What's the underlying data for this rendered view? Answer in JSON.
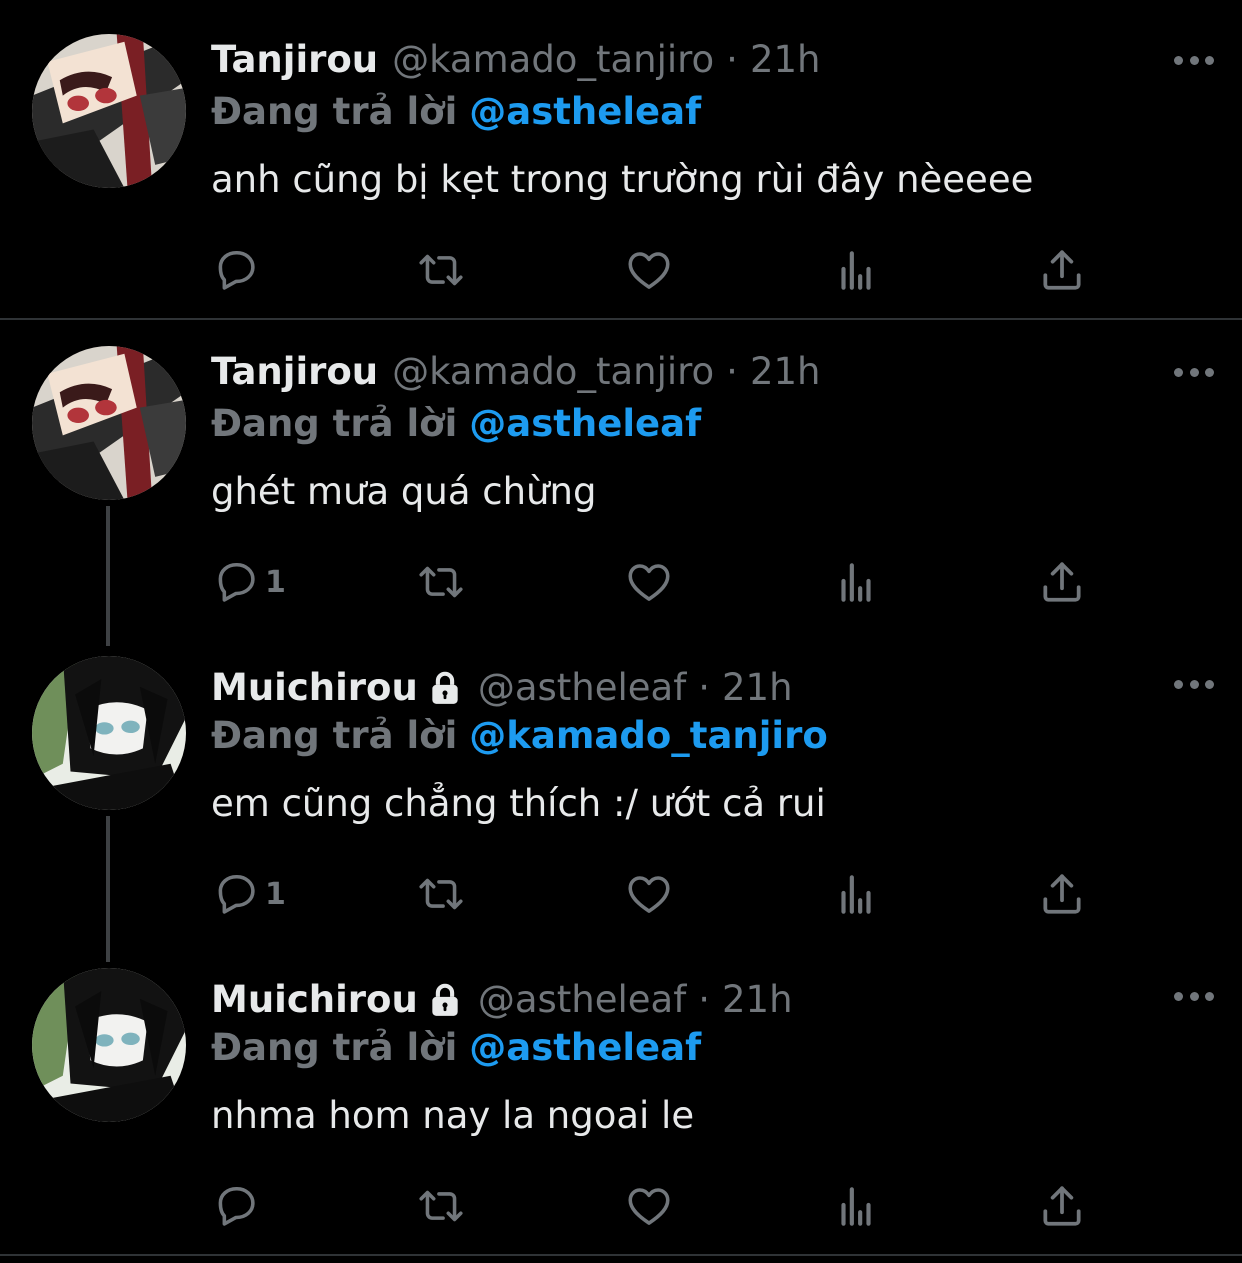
{
  "theme": {
    "background": "#000000",
    "text": "#e7e9ea",
    "muted": "#71767b",
    "accent": "#1d9bf0",
    "divider": "#2f3336"
  },
  "icons": {
    "reply": "reply-icon",
    "retweet": "retweet-icon",
    "like": "heart-icon",
    "analytics": "analytics-icon",
    "share": "share-icon",
    "more": "more-icon",
    "lock": "lock-icon"
  },
  "tweets": [
    {
      "name": "Tanjirou",
      "handle": "@kamado_tanjiro",
      "dot": "·",
      "time": "21h",
      "protected": false,
      "reply_label": "Đang trả lời",
      "reply_to": "@astheleaf",
      "text": "anh cũng bị kẹt trong trường rùi đây nèeeee",
      "reply_count": ""
    },
    {
      "name": "Tanjirou",
      "handle": "@kamado_tanjiro",
      "dot": "·",
      "time": "21h",
      "protected": false,
      "reply_label": "Đang trả lời",
      "reply_to": "@astheleaf",
      "text": "ghét mưa quá chừng",
      "reply_count": "1"
    },
    {
      "name": "Muichirou",
      "handle": "@astheleaf",
      "dot": "·",
      "time": "21h",
      "protected": true,
      "reply_label": "Đang trả lời",
      "reply_to": "@kamado_tanjiro",
      "text": "em cũng chẳng thích :/ ướt cả rui",
      "reply_count": "1"
    },
    {
      "name": "Muichirou",
      "handle": "@astheleaf",
      "dot": "·",
      "time": "21h",
      "protected": true,
      "reply_label": "Đang trả lời",
      "reply_to": "@astheleaf",
      "text": "nhma hom nay la ngoai le",
      "reply_count": ""
    }
  ]
}
